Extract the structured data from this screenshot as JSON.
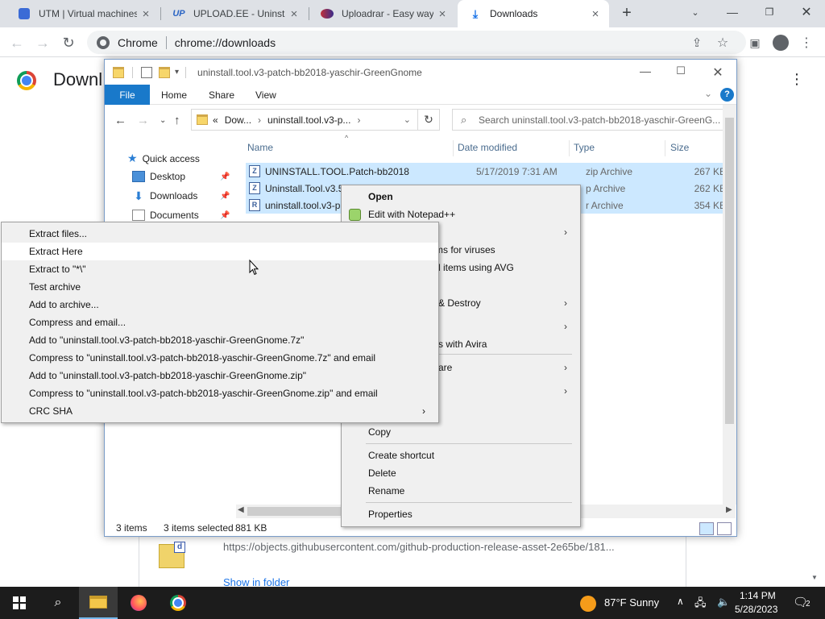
{
  "chrome": {
    "tabs": [
      {
        "title": "UTM | Virtual machines",
        "icon": "utm-icon"
      },
      {
        "title": "UPLOAD.EE - Uninstall",
        "icon": "up-icon"
      },
      {
        "title": "Uploadrar - Easy way t",
        "icon": "uploadrar-icon"
      },
      {
        "title": "Downloads",
        "icon": "download-icon"
      }
    ],
    "omnibox_chip": "Chrome",
    "omnibox_url": "chrome://downloads",
    "page_title": "Downl",
    "download": {
      "url": "https://objects.githubusercontent.com/github-production-release-asset-2e65be/181...",
      "show_in_folder": "Show in folder"
    }
  },
  "explorer": {
    "title": "uninstall.tool.v3-patch-bb2018-yaschir-GreenGnome",
    "ribbon": {
      "file": "File",
      "home": "Home",
      "share": "Share",
      "view": "View",
      "help": "?"
    },
    "address": {
      "prefix": "«",
      "segment1": "Dow...",
      "segment2": "uninstall.tool.v3-p...",
      "chevron": "›"
    },
    "search_placeholder": "Search uninstall.tool.v3-patch-bb2018-yaschir-GreenG...",
    "nav": {
      "quick_access": "Quick access",
      "items": [
        "Desktop",
        "Downloads",
        "Documents"
      ]
    },
    "columns": {
      "name": "Name",
      "date": "Date modified",
      "type": "Type",
      "size": "Size"
    },
    "files": [
      {
        "name": "UNINSTALL.TOOL.Patch-bb2018",
        "date": "5/17/2019 7:31 AM",
        "type": "zip Archive",
        "size": "267 KB",
        "icon": "Z"
      },
      {
        "name": "Uninstall.Tool.v3.5",
        "date": "",
        "type": "p Archive",
        "size": "262 KB",
        "icon": "Z"
      },
      {
        "name": "uninstall.tool.v3-p",
        "date": "",
        "type": "r Archive",
        "size": "354 KB",
        "icon": "R"
      }
    ],
    "status": {
      "count": "3 items",
      "selected": "3 items selected",
      "size": "881 KB"
    }
  },
  "context_menu": {
    "open": "Open",
    "notepad": "Edit with Notepad++",
    "scan": "ms for viruses",
    "avg": "d items using AVG",
    "destroy": "& Destroy",
    "avira": "s with Avira",
    "share": "are",
    "copy": "Copy",
    "shortcut": "Create shortcut",
    "delete": "Delete",
    "rename": "Rename",
    "properties": "Properties"
  },
  "zip_menu": {
    "items": [
      "Extract files...",
      "Extract Here",
      "Extract to \"*\\\"",
      "Test archive",
      "Add to archive...",
      "Compress and email...",
      "Add to \"uninstall.tool.v3-patch-bb2018-yaschir-GreenGnome.7z\"",
      "Compress to \"uninstall.tool.v3-patch-bb2018-yaschir-GreenGnome.7z\" and email",
      "Add to \"uninstall.tool.v3-patch-bb2018-yaschir-GreenGnome.zip\"",
      "Compress to \"uninstall.tool.v3-patch-bb2018-yaschir-GreenGnome.zip\" and email",
      "CRC SHA"
    ]
  },
  "taskbar": {
    "weather": "87°F  Sunny",
    "time": "1:14 PM",
    "date": "5/28/2023",
    "notifications": "2"
  },
  "colors": {
    "accent": "#1979ca",
    "selection": "#cce8ff",
    "taskbar": "#1c1c1c"
  }
}
